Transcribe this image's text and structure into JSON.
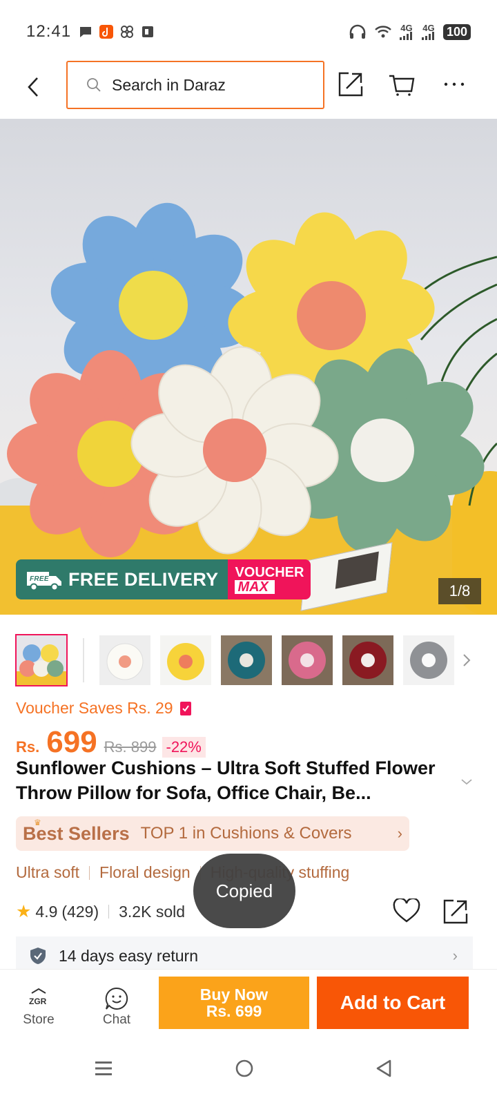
{
  "status_bar": {
    "time": "12:41",
    "network_1": "4G",
    "network_2": "4G",
    "battery": "100"
  },
  "header": {
    "search_placeholder": "Search in Daraz",
    "icons": [
      "back-icon",
      "search-icon",
      "share-icon",
      "cart-icon",
      "more-icon"
    ]
  },
  "gallery": {
    "counter": "1/8",
    "promo_free": "FREE DELIVERY",
    "promo_free_badge": "FREE",
    "promo_voucher_top": "VOUCHER",
    "promo_voucher_bottom": "MAX",
    "thumb_count": 7
  },
  "product": {
    "voucher_text": "Voucher Saves Rs. 29",
    "currency": "Rs.",
    "price": "699",
    "old_price": "Rs. 899",
    "discount": "-22%",
    "title": "Sunflower Cushions – Ultra Soft Stuffed Flower Throw Pillow for Sofa, Office Chair, Be...",
    "best_seller_label": "Best Sellers",
    "best_seller_rank": "TOP 1 in Cushions & Covers",
    "features": [
      "Ultra soft",
      "Floral design",
      "High-quality stuffing"
    ],
    "rating": "4.9",
    "rating_count": "(429)",
    "sold": "3.2K sold",
    "return_policy": "14 days easy return"
  },
  "toast": "Copied",
  "bottom_bar": {
    "store_label": "Store",
    "store_logo": "ZGR",
    "chat_label": "Chat",
    "buy_now_line1": "Buy Now",
    "buy_now_line2": "Rs. 699",
    "add_to_cart": "Add to Cart"
  },
  "colors": {
    "brand_orange": "#f57224",
    "buy_now": "#fba31a",
    "add_to_cart": "#f85606",
    "voucher_pink": "#f0145a",
    "free_delivery_green": "#2f7a6a"
  }
}
